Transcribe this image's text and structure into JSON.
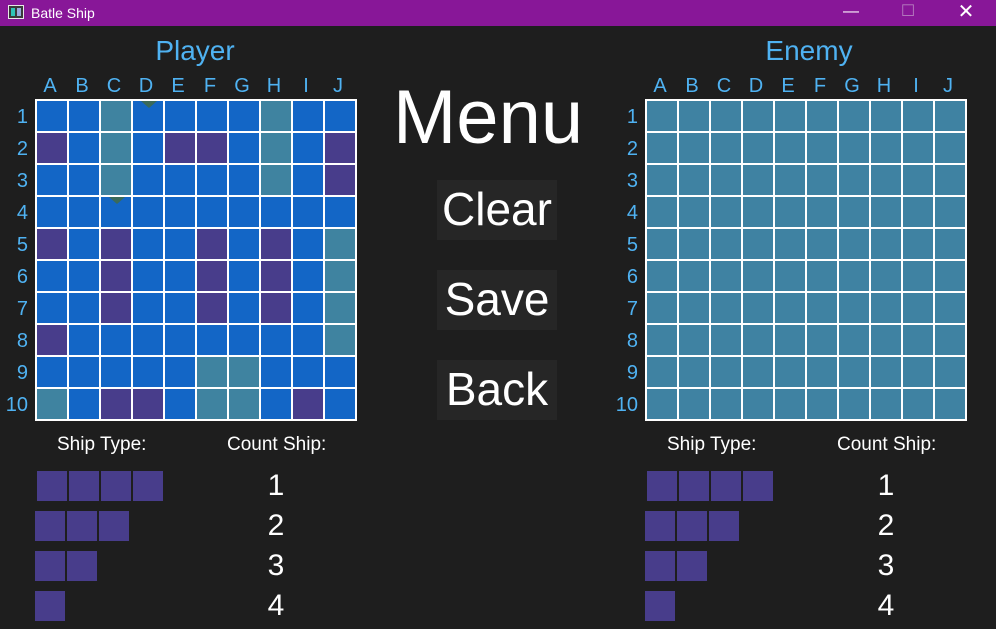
{
  "window": {
    "title": "Batle Ship",
    "minimize": "—",
    "maximize": "☐",
    "close": "✕"
  },
  "columns": [
    "A",
    "B",
    "C",
    "D",
    "E",
    "F",
    "G",
    "H",
    "I",
    "J"
  ],
  "rows": [
    "1",
    "2",
    "3",
    "4",
    "5",
    "6",
    "7",
    "8",
    "9",
    "10"
  ],
  "player": {
    "title": "Player",
    "grid": [
      "wwmTwwwmww",
      "swmwsswmws",
      "wwmwwwwmws",
      "wwTwwwwwww",
      "swswwswswm",
      "wwswwswswm",
      "wwswwswswm",
      "swwwwwwwwm",
      "wwwwwmmwww",
      "mwsswmmwsw"
    ]
  },
  "enemy": {
    "title": "Enemy"
  },
  "menu": {
    "title": "Menu",
    "clear": "Clear",
    "save": "Save",
    "back": "Back"
  },
  "legend": {
    "ship_type_label": "Ship Type:",
    "count_label": "Count Ship:",
    "ships": [
      {
        "size": 4,
        "count": "1"
      },
      {
        "size": 3,
        "count": "2"
      },
      {
        "size": 2,
        "count": "3"
      },
      {
        "size": 1,
        "count": "4"
      }
    ]
  },
  "colors": {
    "water": "#1366c6",
    "ship": "#483d8b",
    "miss": "#3f83a0",
    "title": "#4fb2f2",
    "titlebar": "#881798"
  }
}
